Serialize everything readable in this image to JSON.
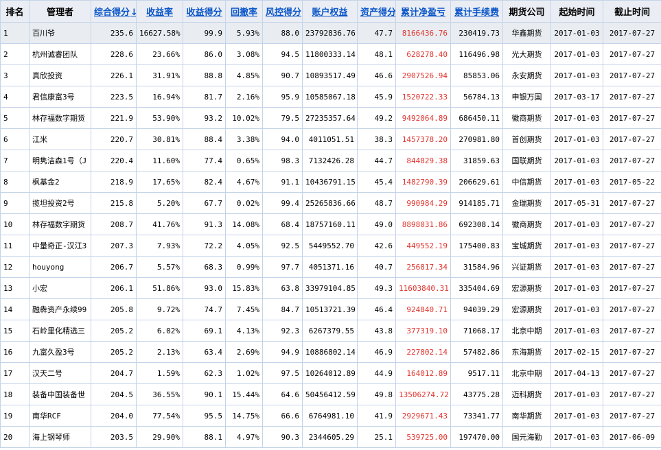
{
  "headers": [
    {
      "key": "rank",
      "label": "排名",
      "sortable": false
    },
    {
      "key": "manager",
      "label": "管理者",
      "sortable": false
    },
    {
      "key": "total_score",
      "label": "综合得分",
      "sortable": true,
      "sorted": true,
      "sort_arrow": "↓"
    },
    {
      "key": "return_rate",
      "label": "收益率",
      "sortable": true
    },
    {
      "key": "return_score",
      "label": "收益得分",
      "sortable": true
    },
    {
      "key": "drawdown",
      "label": "回撤率",
      "sortable": true
    },
    {
      "key": "risk_score",
      "label": "风控得分",
      "sortable": true
    },
    {
      "key": "equity",
      "label": "账户权益",
      "sortable": true
    },
    {
      "key": "asset_score",
      "label": "资产得分",
      "sortable": true
    },
    {
      "key": "net_profit",
      "label": "累计净盈亏",
      "sortable": true
    },
    {
      "key": "fees",
      "label": "累计手续费",
      "sortable": true
    },
    {
      "key": "company",
      "label": "期货公司",
      "sortable": false
    },
    {
      "key": "start_date",
      "label": "起始时间",
      "sortable": false
    },
    {
      "key": "end_date",
      "label": "截止时间",
      "sortable": false
    }
  ],
  "colors": {
    "link": "#0a55c8",
    "profit": "#e0342e",
    "header_bg": "#eaeef4",
    "border": "#c4d3e8"
  },
  "rows": [
    {
      "rank": "1",
      "manager": "百川爷",
      "total_score": "235.6",
      "return_rate": "16627.58%",
      "return_score": "99.9",
      "drawdown": "5.93%",
      "risk_score": "88.0",
      "equity": "23792836.76",
      "asset_score": "47.7",
      "net_profit": "8166436.76",
      "fees": "230419.73",
      "company": "华鑫期货",
      "start_date": "2017-01-03",
      "end_date": "2017-07-27"
    },
    {
      "rank": "2",
      "manager": "杭州诚睿团队",
      "total_score": "228.6",
      "return_rate": "23.66%",
      "return_score": "86.0",
      "drawdown": "3.08%",
      "risk_score": "94.5",
      "equity": "11800333.14",
      "asset_score": "48.1",
      "net_profit": "628278.40",
      "fees": "116496.98",
      "company": "光大期货",
      "start_date": "2017-01-03",
      "end_date": "2017-07-27"
    },
    {
      "rank": "3",
      "manager": "真欣投资",
      "total_score": "226.1",
      "return_rate": "31.91%",
      "return_score": "88.8",
      "drawdown": "4.85%",
      "risk_score": "90.7",
      "equity": "10893517.49",
      "asset_score": "46.6",
      "net_profit": "2907526.94",
      "fees": "85853.06",
      "company": "永安期货",
      "start_date": "2017-01-03",
      "end_date": "2017-07-27"
    },
    {
      "rank": "4",
      "manager": "君信康富3号",
      "total_score": "223.5",
      "return_rate": "16.94%",
      "return_score": "81.7",
      "drawdown": "2.16%",
      "risk_score": "95.9",
      "equity": "10585067.18",
      "asset_score": "45.9",
      "net_profit": "1520722.33",
      "fees": "56784.13",
      "company": "申银万国",
      "start_date": "2017-03-17",
      "end_date": "2017-07-27"
    },
    {
      "rank": "5",
      "manager": "林存福数字期货",
      "total_score": "221.9",
      "return_rate": "53.90%",
      "return_score": "93.2",
      "drawdown": "10.02%",
      "risk_score": "79.5",
      "equity": "27235357.64",
      "asset_score": "49.2",
      "net_profit": "9492064.89",
      "fees": "686450.11",
      "company": "徽商期货",
      "start_date": "2017-01-03",
      "end_date": "2017-07-27"
    },
    {
      "rank": "6",
      "manager": "江米",
      "total_score": "220.7",
      "return_rate": "30.81%",
      "return_score": "88.4",
      "drawdown": "3.38%",
      "risk_score": "94.0",
      "equity": "4011051.51",
      "asset_score": "38.3",
      "net_profit": "1457378.20",
      "fees": "270981.80",
      "company": "首创期货",
      "start_date": "2017-01-03",
      "end_date": "2017-07-27"
    },
    {
      "rank": "7",
      "manager": "明隽洁森1号（J",
      "total_score": "220.4",
      "return_rate": "11.60%",
      "return_score": "77.4",
      "drawdown": "0.65%",
      "risk_score": "98.3",
      "equity": "7132426.28",
      "asset_score": "44.7",
      "net_profit": "844829.38",
      "fees": "31859.63",
      "company": "国联期货",
      "start_date": "2017-01-03",
      "end_date": "2017-07-27"
    },
    {
      "rank": "8",
      "manager": "枫基金2",
      "total_score": "218.9",
      "return_rate": "17.65%",
      "return_score": "82.4",
      "drawdown": "4.67%",
      "risk_score": "91.1",
      "equity": "10436791.15",
      "asset_score": "45.4",
      "net_profit": "1482790.39",
      "fees": "206629.61",
      "company": "中信期货",
      "start_date": "2017-01-03",
      "end_date": "2017-05-22"
    },
    {
      "rank": "9",
      "manager": "揽坦投资2号",
      "total_score": "215.8",
      "return_rate": "5.20%",
      "return_score": "67.7",
      "drawdown": "0.02%",
      "risk_score": "99.4",
      "equity": "25265836.66",
      "asset_score": "48.7",
      "net_profit": "990984.29",
      "fees": "914185.71",
      "company": "金瑞期货",
      "start_date": "2017-05-31",
      "end_date": "2017-07-27"
    },
    {
      "rank": "10",
      "manager": "林存福数字期货",
      "total_score": "208.7",
      "return_rate": "41.76%",
      "return_score": "91.3",
      "drawdown": "14.08%",
      "risk_score": "68.4",
      "equity": "18757160.11",
      "asset_score": "49.0",
      "net_profit": "8898031.86",
      "fees": "692308.14",
      "company": "徽商期货",
      "start_date": "2017-01-03",
      "end_date": "2017-07-27"
    },
    {
      "rank": "11",
      "manager": "中量奇正-汉江3",
      "total_score": "207.3",
      "return_rate": "7.93%",
      "return_score": "72.2",
      "drawdown": "4.05%",
      "risk_score": "92.5",
      "equity": "5449552.70",
      "asset_score": "42.6",
      "net_profit": "449552.19",
      "fees": "175400.83",
      "company": "宝城期货",
      "start_date": "2017-01-03",
      "end_date": "2017-07-27"
    },
    {
      "rank": "12",
      "manager": "houyong",
      "total_score": "206.7",
      "return_rate": "5.57%",
      "return_score": "68.3",
      "drawdown": "0.99%",
      "risk_score": "97.7",
      "equity": "4051371.16",
      "asset_score": "40.7",
      "net_profit": "256817.34",
      "fees": "31584.96",
      "company": "兴证期货",
      "start_date": "2017-01-03",
      "end_date": "2017-07-27"
    },
    {
      "rank": "13",
      "manager": "小宏",
      "total_score": "206.1",
      "return_rate": "51.86%",
      "return_score": "93.0",
      "drawdown": "15.83%",
      "risk_score": "63.8",
      "equity": "33979104.85",
      "asset_score": "49.3",
      "net_profit": "11603840.31",
      "fees": "335404.69",
      "company": "宏源期货",
      "start_date": "2017-01-03",
      "end_date": "2017-07-27"
    },
    {
      "rank": "14",
      "manager": "融犇资产永续99",
      "total_score": "205.8",
      "return_rate": "9.72%",
      "return_score": "74.7",
      "drawdown": "7.45%",
      "risk_score": "84.7",
      "equity": "10513721.39",
      "asset_score": "46.4",
      "net_profit": "924840.71",
      "fees": "94039.29",
      "company": "宏源期货",
      "start_date": "2017-01-03",
      "end_date": "2017-07-27"
    },
    {
      "rank": "15",
      "manager": "石岭里化精选三",
      "total_score": "205.2",
      "return_rate": "6.02%",
      "return_score": "69.1",
      "drawdown": "4.13%",
      "risk_score": "92.3",
      "equity": "6267379.55",
      "asset_score": "43.8",
      "net_profit": "377319.10",
      "fees": "71068.17",
      "company": "北京中期",
      "start_date": "2017-01-03",
      "end_date": "2017-07-27"
    },
    {
      "rank": "16",
      "manager": "九富久盈3号",
      "total_score": "205.2",
      "return_rate": "2.13%",
      "return_score": "63.4",
      "drawdown": "2.69%",
      "risk_score": "94.9",
      "equity": "10886802.14",
      "asset_score": "46.9",
      "net_profit": "227802.14",
      "fees": "57482.86",
      "company": "东海期货",
      "start_date": "2017-02-15",
      "end_date": "2017-07-27"
    },
    {
      "rank": "17",
      "manager": "汉天二号",
      "total_score": "204.7",
      "return_rate": "1.59%",
      "return_score": "62.3",
      "drawdown": "1.02%",
      "risk_score": "97.5",
      "equity": "10264012.89",
      "asset_score": "44.9",
      "net_profit": "164012.89",
      "fees": "9517.11",
      "company": "北京中期",
      "start_date": "2017-04-13",
      "end_date": "2017-07-27"
    },
    {
      "rank": "18",
      "manager": "装备中国装备世",
      "total_score": "204.5",
      "return_rate": "36.55%",
      "return_score": "90.1",
      "drawdown": "15.44%",
      "risk_score": "64.6",
      "equity": "50456412.59",
      "asset_score": "49.8",
      "net_profit": "13506274.72",
      "fees": "43775.28",
      "company": "迈科期货",
      "start_date": "2017-01-03",
      "end_date": "2017-07-27"
    },
    {
      "rank": "19",
      "manager": "南华RCF",
      "total_score": "204.0",
      "return_rate": "77.54%",
      "return_score": "95.5",
      "drawdown": "14.75%",
      "risk_score": "66.6",
      "equity": "6764981.10",
      "asset_score": "41.9",
      "net_profit": "2929671.43",
      "fees": "73341.77",
      "company": "南华期货",
      "start_date": "2017-01-03",
      "end_date": "2017-07-27"
    },
    {
      "rank": "20",
      "manager": "海上钢琴师",
      "total_score": "203.5",
      "return_rate": "29.90%",
      "return_score": "88.1",
      "drawdown": "4.97%",
      "risk_score": "90.3",
      "equity": "2344605.29",
      "asset_score": "25.1",
      "net_profit": "539725.00",
      "fees": "197470.00",
      "company": "国元海勤",
      "start_date": "2017-01-03",
      "end_date": "2017-06-09"
    }
  ]
}
